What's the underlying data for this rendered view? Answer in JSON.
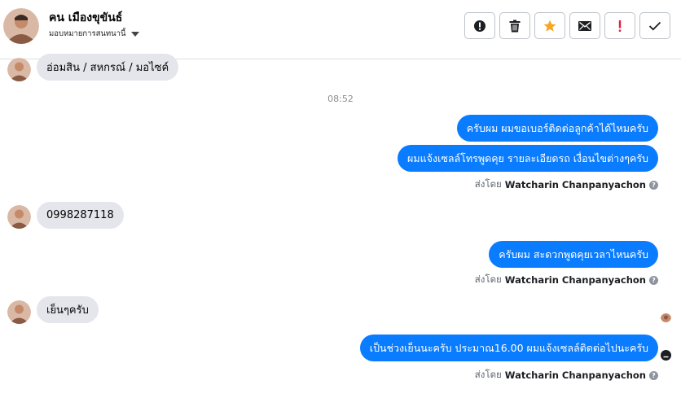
{
  "header": {
    "contact_name": "คน เมืองขุขันธ์",
    "assign_label": "มอบหมายการสนทนานี้"
  },
  "actions": [
    {
      "icon": "alert-circle-icon"
    },
    {
      "icon": "trash-icon"
    },
    {
      "icon": "star-icon",
      "color": "#f5a623"
    },
    {
      "icon": "envelope-icon"
    },
    {
      "icon": "exclamation-icon",
      "color": "#e41e3f"
    },
    {
      "icon": "check-icon"
    }
  ],
  "thread": {
    "messages_in": [
      {
        "text": "อ่อมสิน / สหกรณ์ / มอไซค์"
      },
      {
        "text": "0998287118"
      },
      {
        "text": "เย็นๆครับ"
      }
    ],
    "timestamp": "08:52",
    "messages_out": [
      {
        "text": "ครับผม ผมขอเบอร์ติดต่อลูกค้าได้ไหมครับ"
      },
      {
        "text": "ผมแจ้งเซลล์โทรพูดคุย รายละเอียดรถ เงื่อนไขต่างๆครับ"
      },
      {
        "text": "ครับผม สะดวกพูดคุยเวลาไหนครับ"
      },
      {
        "text": "เป็นช่วงเย็นนะครับ ประมาณ16.00 ผมแจ้งเซลล์ติดต่อไปนะครับ"
      }
    ],
    "sent_by_prefix": "ส่งโดย",
    "sent_by_name": "Watcharin Chanpanyachon",
    "info_mark": "?"
  },
  "colors": {
    "outgoing_bubble": "#0a7cff",
    "incoming_bubble": "#e4e6eb"
  }
}
